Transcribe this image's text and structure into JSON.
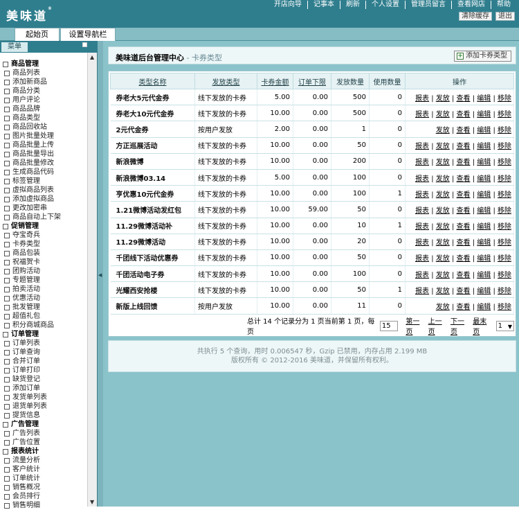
{
  "logo": {
    "text": "美味道",
    "mark": "®"
  },
  "topnav": [
    "开店向导",
    "记事本",
    "刷新",
    "个人设置",
    "管理员留言",
    "查看网店",
    "帮助"
  ],
  "header_buttons": [
    "清除缓存",
    "退出"
  ],
  "tabs": [
    "起始页",
    "设置导航栏"
  ],
  "sidebar": {
    "title": "菜单",
    "groups": [
      {
        "label": "商品管理",
        "items": [
          "商品列表",
          "添加新商品",
          "商品分类",
          "用户评论",
          "商品品牌",
          "商品类型",
          "商品回收站",
          "图片批量处理",
          "商品批量上传",
          "商品批量导出",
          "商品批量修改",
          "生成商品代码",
          "标签管理",
          "虚拟商品列表",
          "添加虚拟商品",
          "更改加密串",
          "商品自动上下架"
        ]
      },
      {
        "label": "促销管理",
        "items": [
          "夺宝奇兵",
          "卡券类型",
          "商品包装",
          "祝福贺卡",
          "团购活动",
          "专题管理",
          "拍卖活动",
          "优惠活动",
          "批发管理",
          "超值礼包",
          "积分商城商品"
        ]
      },
      {
        "label": "订单管理",
        "items": [
          "订单列表",
          "订单查询",
          "合并订单",
          "订单打印",
          "缺货登记",
          "添加订单",
          "发货单列表",
          "退货单列表",
          "提货信息"
        ]
      },
      {
        "label": "广告管理",
        "items": [
          "广告列表",
          "广告位置"
        ]
      },
      {
        "label": "报表统计",
        "items": [
          "流量分析",
          "客户统计",
          "订单统计",
          "销售概况",
          "会员排行",
          "销售明细"
        ]
      }
    ]
  },
  "page": {
    "title": "美味道后台管理中心",
    "subtitle": " - 卡券类型",
    "add_button": "添加卡券类型"
  },
  "table": {
    "headers": [
      "类型名称",
      "发放类型",
      "卡券金额",
      "订单下限",
      "发放数量",
      "使用数量",
      "操作"
    ],
    "rows": [
      {
        "name": "券老大5元代金券",
        "type": "线下发放的卡券",
        "amount": "5.00",
        "min": "0.00",
        "issued": "500",
        "used": "0",
        "ops": [
          "报表",
          "发放",
          "查看",
          "编辑",
          "移除"
        ]
      },
      {
        "name": "券老大10元代金券",
        "type": "线下发放的卡券",
        "amount": "10.00",
        "min": "0.00",
        "issued": "500",
        "used": "0",
        "ops": [
          "报表",
          "发放",
          "查看",
          "编辑",
          "移除"
        ]
      },
      {
        "name": "2元代金券",
        "type": "按用户发放",
        "amount": "2.00",
        "min": "0.00",
        "issued": "1",
        "used": "0",
        "ops": [
          "发放",
          "查看",
          "编辑",
          "移除"
        ]
      },
      {
        "name": "方正巡展活动",
        "type": "线下发放的卡券",
        "amount": "10.00",
        "min": "0.00",
        "issued": "50",
        "used": "0",
        "ops": [
          "报表",
          "发放",
          "查看",
          "编辑",
          "移除"
        ]
      },
      {
        "name": "新浪微博",
        "type": "线下发放的卡券",
        "amount": "10.00",
        "min": "0.00",
        "issued": "200",
        "used": "0",
        "ops": [
          "报表",
          "发放",
          "查看",
          "编辑",
          "移除"
        ]
      },
      {
        "name": "新浪微博03.14",
        "type": "线下发放的卡券",
        "amount": "5.00",
        "min": "0.00",
        "issued": "100",
        "used": "0",
        "ops": [
          "报表",
          "发放",
          "查看",
          "编辑",
          "移除"
        ]
      },
      {
        "name": "亨优惠10元代金券",
        "type": "线下发放的卡券",
        "amount": "10.00",
        "min": "0.00",
        "issued": "100",
        "used": "1",
        "ops": [
          "报表",
          "发放",
          "查看",
          "编辑",
          "移除"
        ]
      },
      {
        "name": "1.21微博活动发红包",
        "type": "线下发放的卡券",
        "amount": "10.00",
        "min": "59.00",
        "issued": "50",
        "used": "0",
        "ops": [
          "报表",
          "发放",
          "查看",
          "编辑",
          "移除"
        ]
      },
      {
        "name": "11.29微博活动补",
        "type": "线下发放的卡券",
        "amount": "10.00",
        "min": "0.00",
        "issued": "10",
        "used": "1",
        "ops": [
          "报表",
          "发放",
          "查看",
          "编辑",
          "移除"
        ]
      },
      {
        "name": "11.29微博活动",
        "type": "线下发放的卡券",
        "amount": "10.00",
        "min": "0.00",
        "issued": "20",
        "used": "0",
        "ops": [
          "报表",
          "发放",
          "查看",
          "编辑",
          "移除"
        ]
      },
      {
        "name": "千团线下活动优惠券",
        "type": "线下发放的卡券",
        "amount": "10.00",
        "min": "0.00",
        "issued": "50",
        "used": "0",
        "ops": [
          "报表",
          "发放",
          "查看",
          "编辑",
          "移除"
        ]
      },
      {
        "name": "千团活动电子券",
        "type": "线下发放的卡券",
        "amount": "10.00",
        "min": "0.00",
        "issued": "100",
        "used": "0",
        "ops": [
          "报表",
          "发放",
          "查看",
          "编辑",
          "移除"
        ]
      },
      {
        "name": "光耀西安抢楼",
        "type": "线下发放的卡券",
        "amount": "10.00",
        "min": "0.00",
        "issued": "50",
        "used": "1",
        "ops": [
          "报表",
          "发放",
          "查看",
          "编辑",
          "移除"
        ]
      },
      {
        "name": "新版上线回馈",
        "type": "按用户发放",
        "amount": "10.00",
        "min": "0.00",
        "issued": "11",
        "used": "0",
        "ops": [
          "发放",
          "查看",
          "编辑",
          "移除"
        ]
      }
    ]
  },
  "pager": {
    "summary": "总计 14 个记录分为 1 页当前第 1 页，每页",
    "per_page": "15",
    "links": [
      "第一页",
      "上一页",
      "下一页",
      "最末页"
    ],
    "page_select": "1"
  },
  "footer": {
    "line1": "共执行 5 个查询，用时 0.006547 秒，Gzip 已禁用，内存占用 2.199 MB",
    "line2": "版权所有 © 2012-2016 美味道，并保留所有权利。"
  }
}
